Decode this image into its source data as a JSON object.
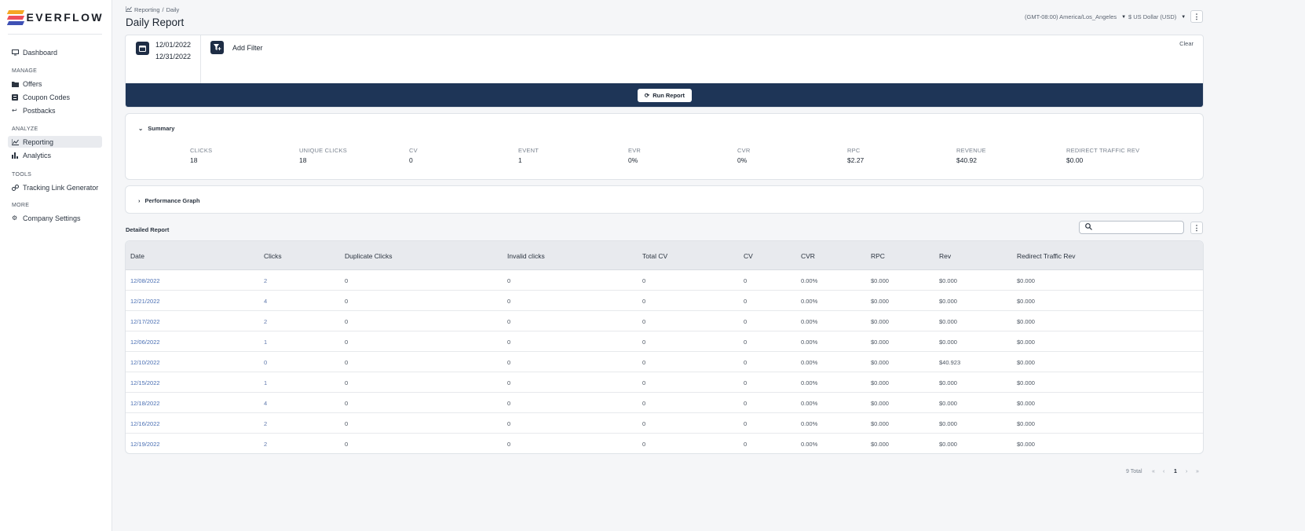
{
  "brand": {
    "name": "EVERFLOW"
  },
  "sidebar": {
    "dashboard": "Dashboard",
    "sections": [
      {
        "title": "MANAGE",
        "items": [
          "Offers",
          "Coupon Codes",
          "Postbacks"
        ]
      },
      {
        "title": "ANALYZE",
        "items": [
          "Reporting",
          "Analytics"
        ]
      },
      {
        "title": "TOOLS",
        "items": [
          "Tracking Link Generator"
        ]
      },
      {
        "title": "MORE",
        "items": [
          "Company Settings"
        ]
      }
    ],
    "active": "Reporting"
  },
  "header": {
    "breadcrumb": [
      "Reporting",
      "Daily"
    ],
    "title": "Daily Report",
    "timezone": "(GMT-08:00) America/Los_Angeles",
    "currency": "$ US Dollar (USD)"
  },
  "filters": {
    "date_start": "12/01/2022",
    "date_end": "12/31/2022",
    "add_filter": "Add Filter",
    "clear": "Clear",
    "run_report": "Run Report"
  },
  "summary": {
    "title": "Summary",
    "metrics": [
      {
        "label": "CLICKS",
        "value": "18"
      },
      {
        "label": "UNIQUE CLICKS",
        "value": "18"
      },
      {
        "label": "CV",
        "value": "0"
      },
      {
        "label": "EVENT",
        "value": "1"
      },
      {
        "label": "EVR",
        "value": "0%"
      },
      {
        "label": "CVR",
        "value": "0%"
      },
      {
        "label": "RPC",
        "value": "$2.27"
      },
      {
        "label": "REVENUE",
        "value": "$40.92"
      },
      {
        "label": "REDIRECT TRAFFIC REV",
        "value": "$0.00"
      }
    ]
  },
  "performance_graph": {
    "title": "Performance Graph"
  },
  "detailed_report": {
    "title": "Detailed Report",
    "columns": [
      "Date",
      "Clicks",
      "Duplicate Clicks",
      "Invalid clicks",
      "Total CV",
      "CV",
      "CVR",
      "RPC",
      "Rev",
      "Redirect Traffic Rev"
    ],
    "rows": [
      [
        "12/08/2022",
        "2",
        "0",
        "0",
        "0",
        "0",
        "0.00%",
        "$0.000",
        "$0.000",
        "$0.000"
      ],
      [
        "12/21/2022",
        "4",
        "0",
        "0",
        "0",
        "0",
        "0.00%",
        "$0.000",
        "$0.000",
        "$0.000"
      ],
      [
        "12/17/2022",
        "2",
        "0",
        "0",
        "0",
        "0",
        "0.00%",
        "$0.000",
        "$0.000",
        "$0.000"
      ],
      [
        "12/06/2022",
        "1",
        "0",
        "0",
        "0",
        "0",
        "0.00%",
        "$0.000",
        "$0.000",
        "$0.000"
      ],
      [
        "12/10/2022",
        "0",
        "0",
        "0",
        "0",
        "0",
        "0.00%",
        "$0.000",
        "$40.923",
        "$0.000"
      ],
      [
        "12/15/2022",
        "1",
        "0",
        "0",
        "0",
        "0",
        "0.00%",
        "$0.000",
        "$0.000",
        "$0.000"
      ],
      [
        "12/18/2022",
        "4",
        "0",
        "0",
        "0",
        "0",
        "0.00%",
        "$0.000",
        "$0.000",
        "$0.000"
      ],
      [
        "12/16/2022",
        "2",
        "0",
        "0",
        "0",
        "0",
        "0.00%",
        "$0.000",
        "$0.000",
        "$0.000"
      ],
      [
        "12/19/2022",
        "2",
        "0",
        "0",
        "0",
        "0",
        "0.00%",
        "$0.000",
        "$0.000",
        "$0.000"
      ]
    ]
  },
  "pagination": {
    "total": "9 Total",
    "current_page": "1"
  },
  "icons": [
    "monitor-icon",
    "folder-icon",
    "coupon-icon",
    "postback-icon",
    "chart-icon",
    "analytics-icon",
    "link-icon",
    "gear-icon",
    "calendar-icon",
    "filter-icon",
    "refresh-icon",
    "search-icon",
    "kebab-icon"
  ],
  "colors": {
    "accent_dark": "#1e3557",
    "link": "#4a6fb3"
  }
}
